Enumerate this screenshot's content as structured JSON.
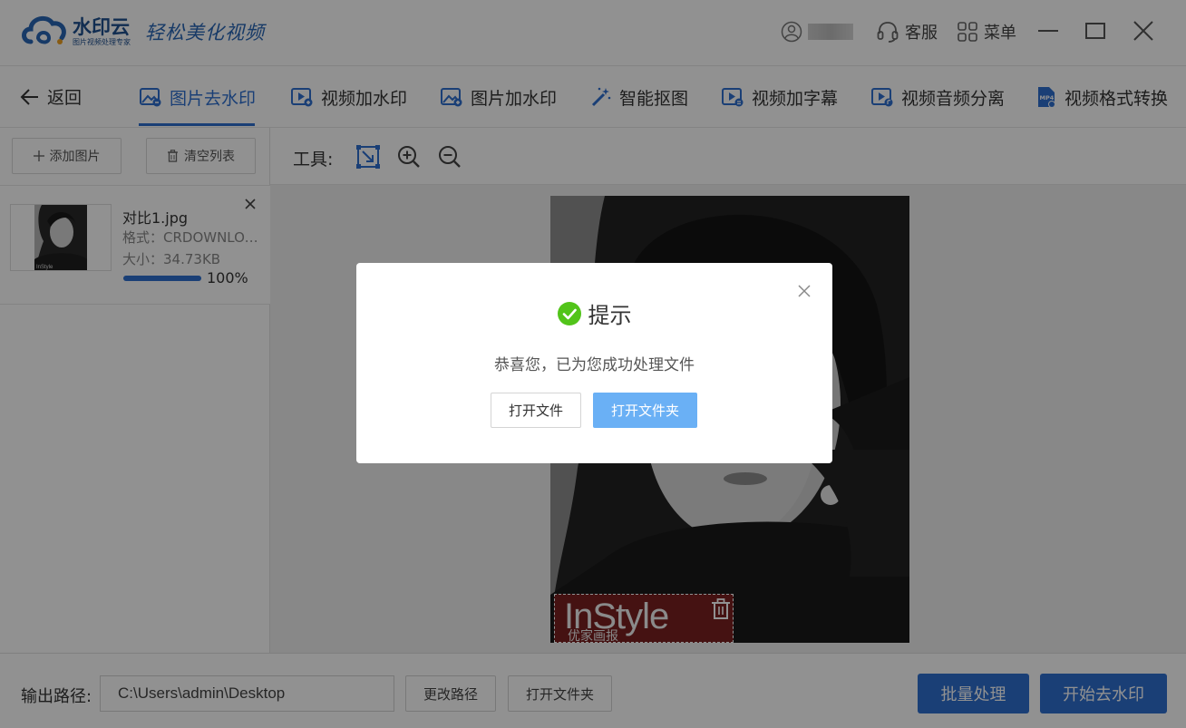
{
  "app": {
    "logo_name": "水印云",
    "logo_sub": "图片视频处理专家",
    "slogan": "轻松美化视频"
  },
  "titlebar": {
    "service_label": "客服",
    "menu_label": "菜单"
  },
  "nav": {
    "back_label": "返回",
    "tabs": [
      {
        "label": "图片去水印",
        "icon": "image-erase-icon",
        "active": true
      },
      {
        "label": "视频加水印",
        "icon": "video-add-icon",
        "active": false
      },
      {
        "label": "图片加水印",
        "icon": "image-add-icon",
        "active": false
      },
      {
        "label": "智能抠图",
        "icon": "magic-wand-icon",
        "active": false
      },
      {
        "label": "视频加字幕",
        "icon": "video-subtitle-icon",
        "active": false
      },
      {
        "label": "视频音频分离",
        "icon": "video-audio-icon",
        "active": false
      },
      {
        "label": "视频格式转换",
        "icon": "mp4-icon",
        "active": false
      }
    ]
  },
  "leftpanel": {
    "add_label": "添加图片",
    "clear_label": "清空列表",
    "files": [
      {
        "name": "对比1.jpg",
        "format": "格式：CRDOWNLOAD",
        "size": "大小：34.73KB",
        "progress_text": "100%",
        "progress": 1.0
      }
    ]
  },
  "workarea": {
    "tools_label": "工具:",
    "watermark_text": "InStyle",
    "watermark_sub": "优家画报"
  },
  "dialog": {
    "title": "提示",
    "message": "恭喜您，已为您成功处理文件",
    "open_file_label": "打开文件",
    "open_folder_label": "打开文件夹"
  },
  "bottombar": {
    "output_label": "输出路径:",
    "output_path": "C:\\Users\\admin\\Desktop",
    "change_path_label": "更改路径",
    "open_folder_label": "打开文件夹",
    "batch_label": "批量处理",
    "start_label": "开始去水印"
  },
  "colors": {
    "accent": "#2e6fd0",
    "dialog_primary": "#6ab0f5",
    "success": "#52c41a"
  }
}
